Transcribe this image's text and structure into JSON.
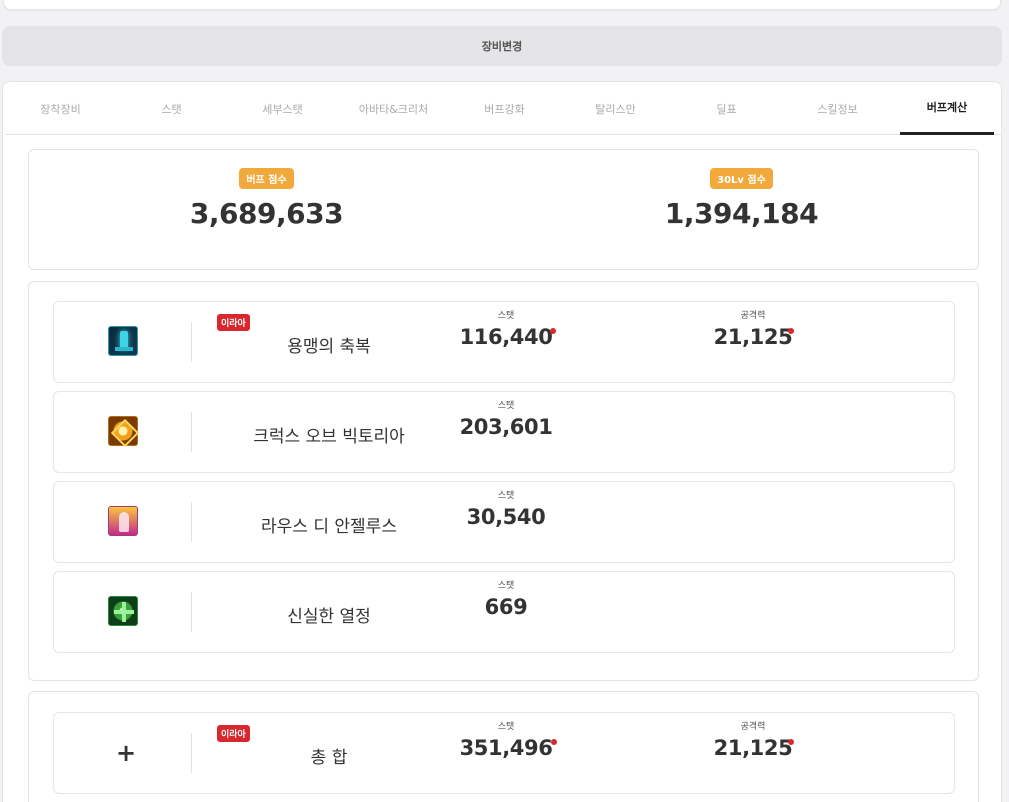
{
  "header": {
    "change_equipment_label": "장비변경"
  },
  "tabs": [
    {
      "label": "장착장비",
      "active": false
    },
    {
      "label": "스탯",
      "active": false
    },
    {
      "label": "세부스탯",
      "active": false
    },
    {
      "label": "아바타&크리처",
      "active": false
    },
    {
      "label": "버프강화",
      "active": false
    },
    {
      "label": "탈리스만",
      "active": false
    },
    {
      "label": "딜표",
      "active": false
    },
    {
      "label": "스킬정보",
      "active": false
    },
    {
      "label": "버프계산",
      "active": true
    }
  ],
  "scores": {
    "buff_score_label": "버프 점수",
    "buff_score_value": "3,689,633",
    "lv30_score_label": "30Lv 점수",
    "lv30_score_value": "1,394,184"
  },
  "skills": [
    {
      "icon": "dragon-blessing-icon",
      "tag": "이라아",
      "name": "용맹의 축복",
      "stat_label": "스탯",
      "stat_value": "116,440",
      "atk_label": "공격력",
      "atk_value": "21,125"
    },
    {
      "icon": "crux-victoria-icon",
      "name": "크럭스 오브 빅토리아",
      "stat_label": "스탯",
      "stat_value": "203,601"
    },
    {
      "icon": "laus-angelus-icon",
      "name": "라우스 디 안젤루스",
      "stat_label": "스탯",
      "stat_value": "30,540"
    },
    {
      "icon": "faithful-passion-icon",
      "name": "신실한 열정",
      "stat_label": "스탯",
      "stat_value": "669"
    }
  ],
  "total": {
    "icon": "plus-icon",
    "tag": "이라아",
    "name": "총 합",
    "stat_label": "스탯",
    "stat_value": "351,496",
    "atk_label": "공격력",
    "atk_value": "21,125"
  },
  "colors": {
    "accent_orange": "#f2a93b",
    "tag_red": "#d8272d",
    "active_tab": "#222222"
  }
}
